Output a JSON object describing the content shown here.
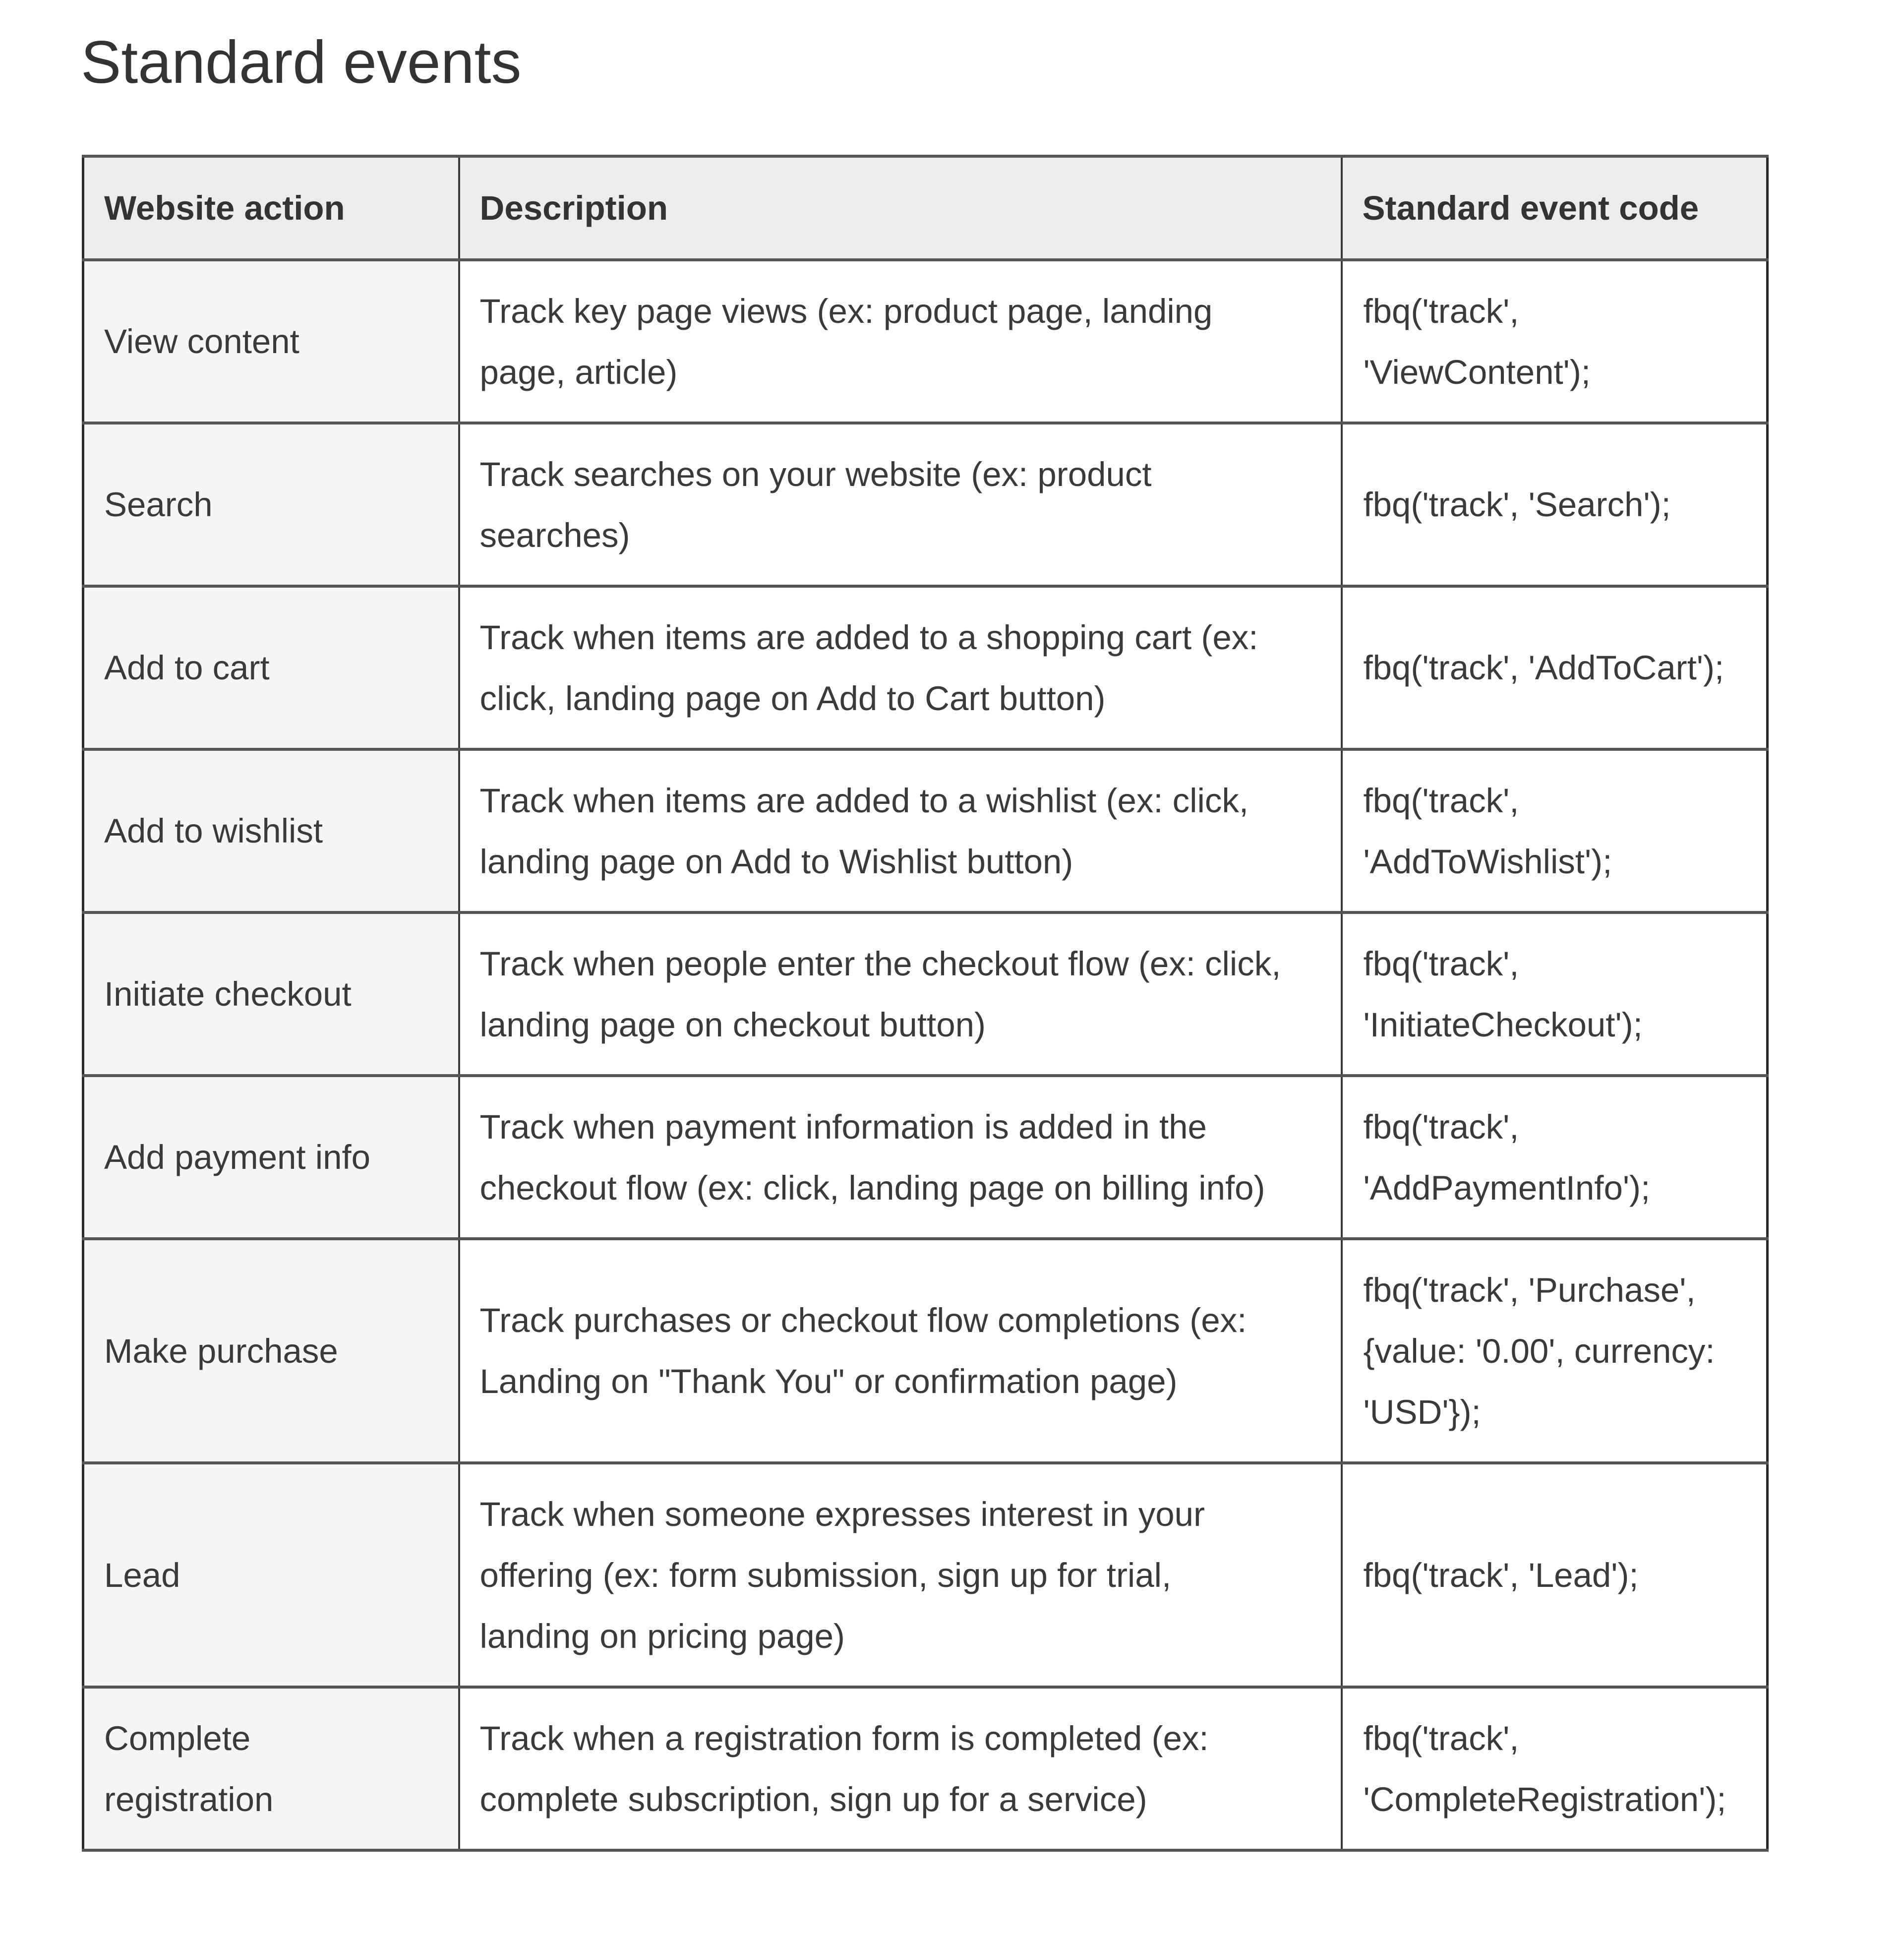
{
  "page": {
    "title": "Standard events"
  },
  "table": {
    "headers": [
      "Website action",
      "Description",
      "Standard event code"
    ],
    "rows": [
      {
        "action": [
          "View content"
        ],
        "description": [
          "Track key page views (ex: product page, landing",
          "page, article)"
        ],
        "code": [
          "fbq('track',",
          "'ViewContent');"
        ]
      },
      {
        "action": [
          "Search"
        ],
        "description": [
          "Track searches on your website (ex: product",
          "searches)"
        ],
        "code": [
          "fbq('track', 'Search');"
        ]
      },
      {
        "action": [
          "Add to cart"
        ],
        "description": [
          "Track when items are added to a shopping cart (ex:",
          "click, landing page on Add to Cart button)"
        ],
        "code": [
          "fbq('track', 'AddToCart');"
        ]
      },
      {
        "action": [
          "Add to wishlist"
        ],
        "description": [
          "Track when items are added to a wishlist (ex: click,",
          "landing page on Add to Wishlist button)"
        ],
        "code": [
          "fbq('track',",
          "'AddToWishlist');"
        ]
      },
      {
        "action": [
          "Initiate checkout"
        ],
        "description": [
          "Track when people enter the checkout flow (ex: click,",
          "landing page on checkout button)"
        ],
        "code": [
          "fbq('track',",
          "'InitiateCheckout');"
        ]
      },
      {
        "action": [
          "Add payment info"
        ],
        "description": [
          "Track when payment information is added in the",
          "checkout flow (ex: click, landing page on billing info)"
        ],
        "code": [
          "fbq('track',",
          "'AddPaymentInfo');"
        ]
      },
      {
        "action": [
          "Make purchase"
        ],
        "description": [
          "Track purchases or checkout flow completions (ex:",
          "Landing on \"Thank You\" or confirmation page)"
        ],
        "code": [
          "fbq('track', 'Purchase',",
          "{value: '0.00', currency:",
          "'USD'});"
        ]
      },
      {
        "action": [
          "Lead"
        ],
        "description": [
          "Track when someone expresses interest in your",
          "offering (ex: form submission, sign up for trial,",
          "landing on pricing page)"
        ],
        "code": [
          "fbq('track', 'Lead');"
        ]
      },
      {
        "action": [
          "Complete",
          "registration"
        ],
        "description": [
          "Track when a registration form is completed (ex:",
          "complete subscription, sign up for a service)"
        ],
        "code": [
          "fbq('track',",
          "'CompleteRegistration');"
        ]
      }
    ]
  }
}
